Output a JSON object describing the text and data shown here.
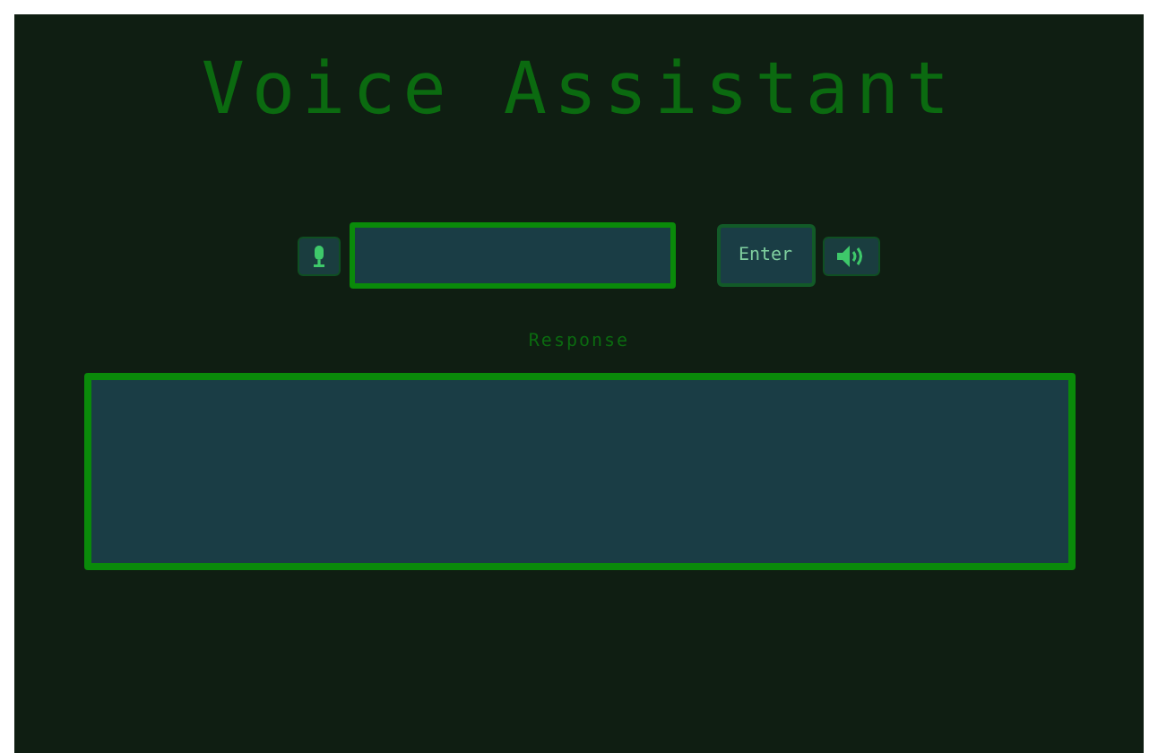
{
  "title": "Voice Assistant",
  "enter_button": {
    "label": "Enter"
  },
  "response": {
    "label": "Response"
  }
}
